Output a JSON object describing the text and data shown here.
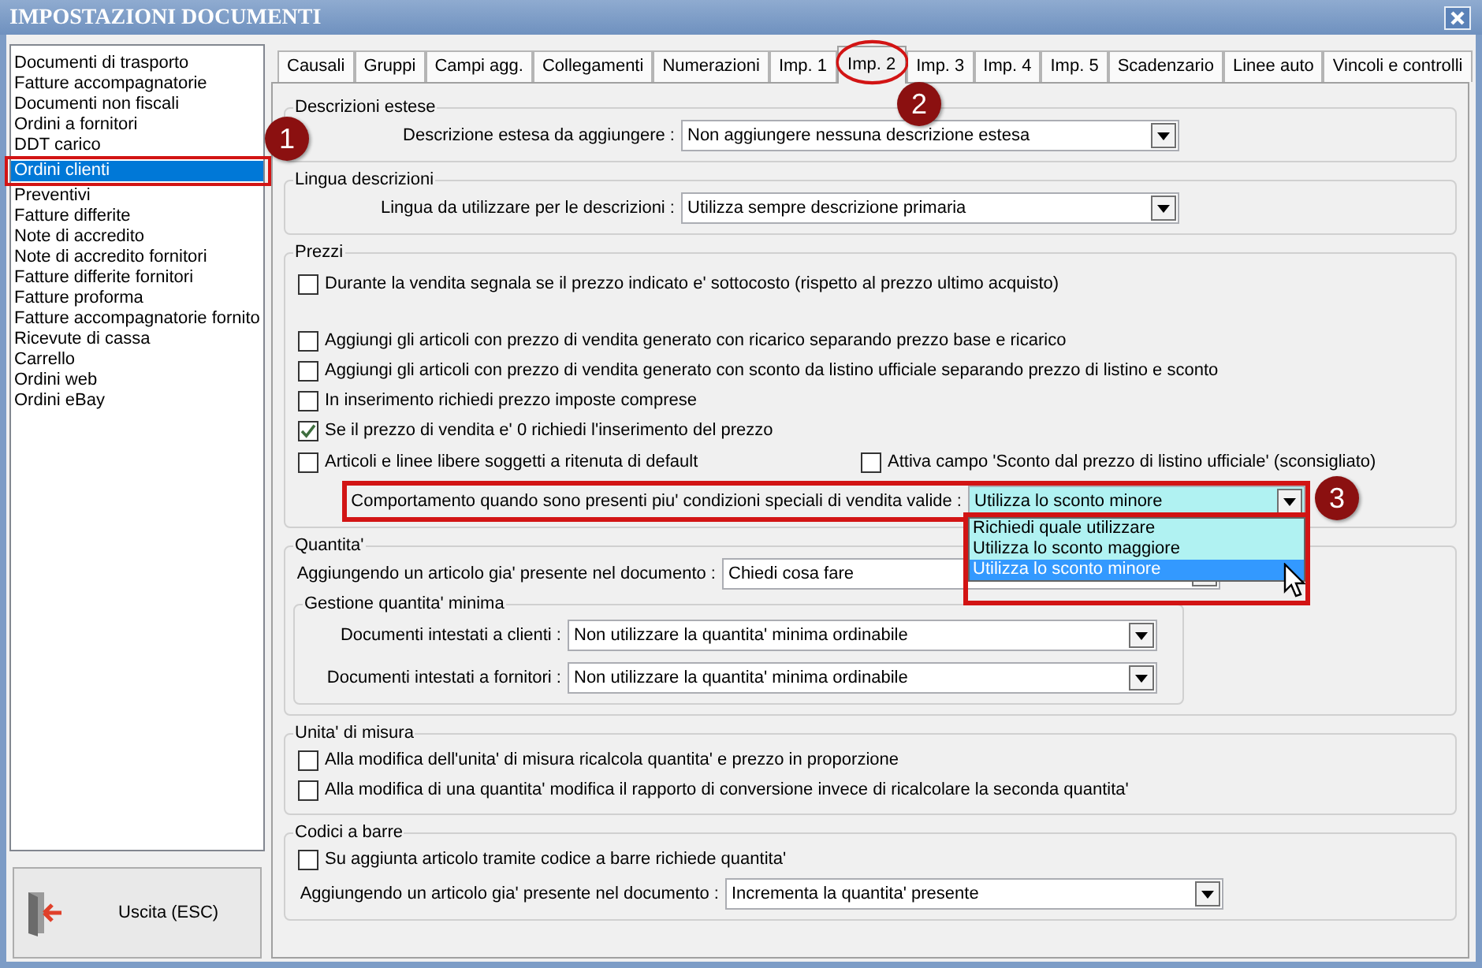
{
  "window": {
    "title": "IMPOSTAZIONI DOCUMENTI"
  },
  "sidebar": {
    "items": [
      {
        "label": "Documenti di trasporto",
        "selected": false
      },
      {
        "label": "Fatture accompagnatorie",
        "selected": false
      },
      {
        "label": "Documenti non fiscali",
        "selected": false
      },
      {
        "label": "Ordini a fornitori",
        "selected": false
      },
      {
        "label": "DDT carico",
        "selected": false
      },
      {
        "label": "Ordini clienti",
        "selected": true
      },
      {
        "label": "Preventivi",
        "selected": false
      },
      {
        "label": "Fatture differite",
        "selected": false
      },
      {
        "label": "Note di accredito",
        "selected": false
      },
      {
        "label": "Note di accredito fornitori",
        "selected": false
      },
      {
        "label": "Fatture differite fornitori",
        "selected": false
      },
      {
        "label": "Fatture proforma",
        "selected": false
      },
      {
        "label": "Fatture accompagnatorie fornito",
        "selected": false
      },
      {
        "label": "Ricevute di cassa",
        "selected": false
      },
      {
        "label": "Carrello",
        "selected": false
      },
      {
        "label": "Ordini web",
        "selected": false
      },
      {
        "label": "Ordini eBay",
        "selected": false
      }
    ]
  },
  "exit_button": {
    "label": "Uscita (ESC)"
  },
  "tabs": [
    {
      "label": "Causali",
      "selected": false
    },
    {
      "label": "Gruppi",
      "selected": false
    },
    {
      "label": "Campi agg.",
      "selected": false
    },
    {
      "label": "Collegamenti",
      "selected": false
    },
    {
      "label": "Numerazioni",
      "selected": false
    },
    {
      "label": "Imp. 1",
      "selected": false
    },
    {
      "label": "Imp. 2",
      "selected": true
    },
    {
      "label": "Imp. 3",
      "selected": false
    },
    {
      "label": "Imp. 4",
      "selected": false
    },
    {
      "label": "Imp. 5",
      "selected": false
    },
    {
      "label": "Scadenzario",
      "selected": false
    },
    {
      "label": "Linee auto",
      "selected": false
    },
    {
      "label": "Vincoli e controlli",
      "selected": false
    }
  ],
  "sections": [
    {
      "title": "Descrizioni estese",
      "rows": [
        {
          "kind": "dropdown",
          "label": "Descrizione estesa da aggiungere :",
          "value": "Non aggiungere nessuna descrizione estesa",
          "focused": false
        }
      ]
    },
    {
      "title": "Lingua descrizioni",
      "rows": [
        {
          "kind": "dropdown",
          "label": "Lingua da utilizzare per le descrizioni :",
          "value": "Utilizza sempre descrizione primaria",
          "focused": false
        }
      ]
    },
    {
      "title": "Prezzi",
      "rows": [
        {
          "kind": "checkbox",
          "label": "Durante la vendita segnala se il prezzo indicato e' sottocosto (rispetto al prezzo ultimo acquisto)",
          "checked": false
        },
        {
          "kind": "checkbox",
          "label": "Aggiungi gli articoli con prezzo di vendita generato con ricarico separando prezzo base e ricarico",
          "checked": false
        },
        {
          "kind": "checkbox",
          "label": "Aggiungi gli articoli con prezzo di vendita generato con sconto da listino ufficiale separando prezzo di listino e sconto",
          "checked": false
        },
        {
          "kind": "checkbox",
          "label": "In inserimento richiedi prezzo imposte comprese",
          "checked": false
        },
        {
          "kind": "checkbox",
          "label": "Se il prezzo di vendita e' 0 richiedi l'inserimento del prezzo",
          "checked": true
        },
        {
          "kind": "checkbox_pair",
          "items": [
            {
              "label": "Articoli e linee libere soggetti a ritenuta di default",
              "checked": false
            },
            {
              "label": "Attiva campo 'Sconto dal prezzo di listino ufficiale' (sconsigliato)",
              "checked": false
            }
          ]
        },
        {
          "kind": "dropdown",
          "label": "Comportamento quando sono presenti piu' condizioni speciali di vendita valide :",
          "value": "Utilizza lo sconto minore",
          "focused": true,
          "options": [
            {
              "label": "Richiedi quale utilizzare",
              "selected": false
            },
            {
              "label": "Utilizza lo sconto maggiore",
              "selected": false
            },
            {
              "label": "Utilizza lo sconto minore",
              "selected": true
            }
          ]
        }
      ]
    },
    {
      "title": "Quantita'",
      "rows": [
        {
          "kind": "dropdown",
          "label": "Aggiungendo un articolo gia' presente nel documento :",
          "value": "Chiedi cosa fare",
          "focused": false
        },
        {
          "kind": "group",
          "title": "Gestione quantita' minima",
          "rows": [
            {
              "kind": "dropdown",
              "label": "Documenti intestati a clienti :",
              "value": "Non utilizzare la quantita' minima ordinabile",
              "focused": false
            },
            {
              "kind": "dropdown",
              "label": "Documenti intestati a fornitori :",
              "value": "Non utilizzare la quantita' minima ordinabile",
              "focused": false
            }
          ]
        }
      ]
    },
    {
      "title": "Unita' di misura",
      "rows": [
        {
          "kind": "checkbox",
          "label": "Alla modifica dell'unita' di misura ricalcola quantita' e prezzo in proporzione",
          "checked": false
        },
        {
          "kind": "checkbox",
          "label": "Alla modifica di una quantita' modifica il rapporto di conversione invece di ricalcolare la seconda quantita'",
          "checked": false
        }
      ]
    },
    {
      "title": "Codici a barre",
      "rows": [
        {
          "kind": "checkbox",
          "label": "Su aggiunta articolo tramite codice a barre richiede quantita'",
          "checked": false
        },
        {
          "kind": "dropdown",
          "label": "Aggiungendo un articolo gia' presente nel documento :",
          "value": "Incrementa la quantita' presente",
          "focused": false
        }
      ]
    }
  ],
  "annotations": [
    {
      "label": "1"
    },
    {
      "label": "2"
    },
    {
      "label": "3"
    }
  ]
}
